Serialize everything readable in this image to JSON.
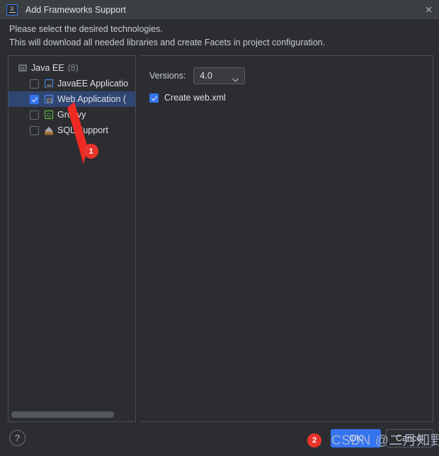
{
  "window": {
    "title": "Add Frameworks Support",
    "app_icon": "intellij-idea-icon",
    "close_icon": "close-icon"
  },
  "description": {
    "line1": "Please select the desired technologies.",
    "line2": "This will download all needed libraries and create Facets in project configuration."
  },
  "tree": {
    "group": {
      "label": "Java EE",
      "count": "(8)",
      "icon": "java-ee-module-icon"
    },
    "items": [
      {
        "label": "JavaEE Applicatio",
        "icon": "javaee-application-icon",
        "checked": false,
        "selected": false
      },
      {
        "label": "Web Application (",
        "icon": "web-application-globe-icon",
        "checked": true,
        "selected": true
      },
      {
        "label": "Groovy",
        "icon": "groovy-icon",
        "checked": false,
        "selected": false
      },
      {
        "label": "SQL Support",
        "icon": "sql-support-icon",
        "checked": false,
        "selected": false
      }
    ],
    "scrollbar": "horizontal-scrollbar"
  },
  "details": {
    "versions_label": "Versions:",
    "versions_value": "4.0",
    "versions_chevron": "chevron-down-icon",
    "create_webxml_label": "Create web.xml",
    "create_webxml_checked": true
  },
  "buttons": {
    "help": "?",
    "ok": "OK",
    "cancel": "Cancel"
  },
  "annotations": {
    "badge_1": "1",
    "badge_2": "2",
    "arrow": "red-arrow-pointing-to-web-application",
    "watermark": "CSDN @二月知野"
  },
  "colors": {
    "accent": "#3574f0",
    "selection": "#2f4673",
    "titlebar": "#3c3f41",
    "background": "#2b2d30",
    "annotation_red": "#e8352b",
    "watermark": "#a9b7d0"
  }
}
